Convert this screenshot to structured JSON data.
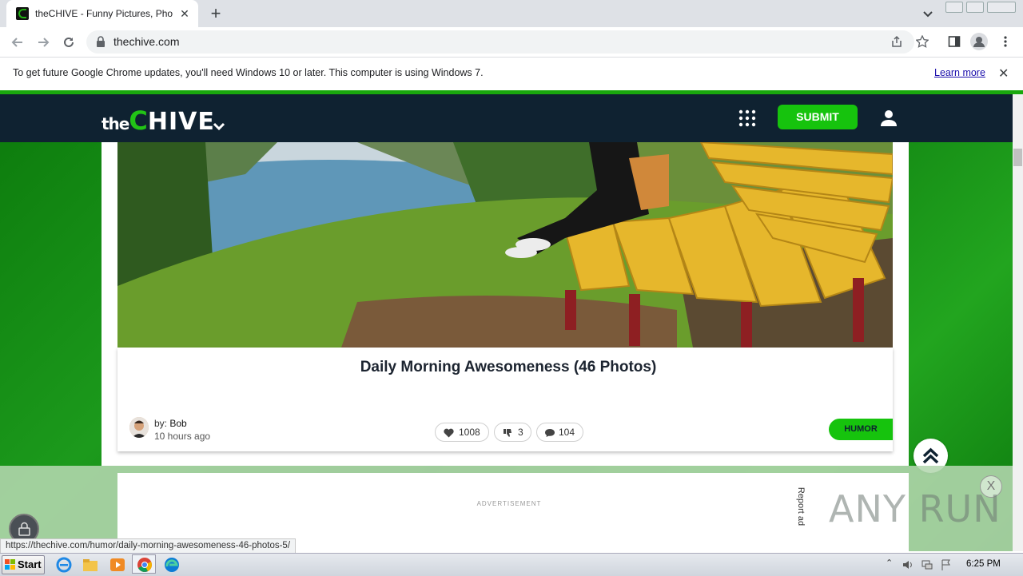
{
  "browser": {
    "tab_title": "theCHIVE - Funny Pictures, Photos, Memes",
    "tab_close": "✕",
    "new_tab": "+",
    "url": "thechive.com",
    "info_bar": {
      "message": "To get future Google Chrome updates, you'll need Windows 10 or later. This computer is using Windows 7.",
      "learn_more": "Learn more",
      "close": "✕"
    },
    "status_url": "https://thechive.com/humor/daily-morning-awesomeness-46-photos-5/"
  },
  "site": {
    "logo_the": "the",
    "logo_c": "C",
    "logo_hive": "HIVE",
    "submit_label": "SUBMIT",
    "article": {
      "title": "Daily Morning Awesomeness (46 Photos)",
      "author_prefix": "by:",
      "author": "Bob",
      "time": "10 hours ago",
      "likes": "1008",
      "dislikes": "3",
      "comments": "104",
      "category": "HUMOR"
    },
    "ad": {
      "label": "ADVERTISEMENT",
      "report": "Report ad",
      "close": "X"
    },
    "watermark": "ANY RUN"
  },
  "taskbar": {
    "start": "Start",
    "clock": "6:25 PM"
  },
  "colors": {
    "brand_green": "#16c30d",
    "nav_dark": "#0f2231",
    "link_blue": "#1a0dab"
  }
}
